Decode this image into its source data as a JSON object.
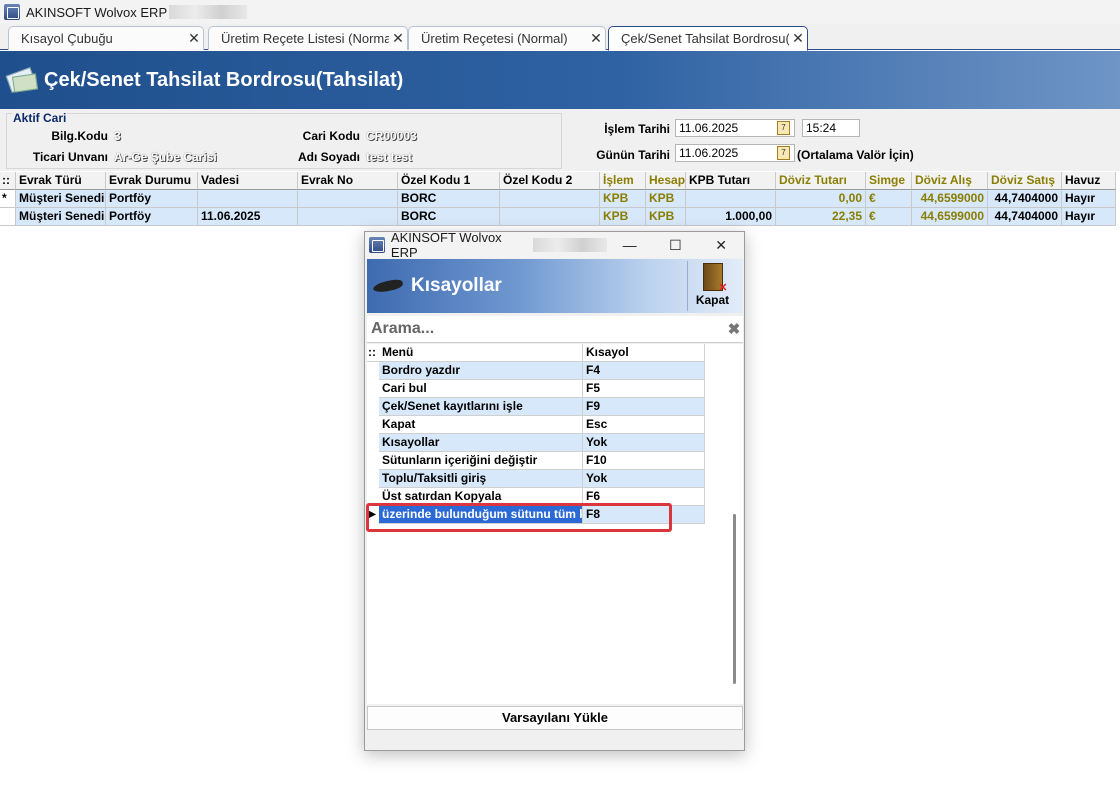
{
  "app": {
    "title": "AKINSOFT Wolvox ERP"
  },
  "tabs": [
    {
      "label": "Kısayol Çubuğu"
    },
    {
      "label": "Üretim Reçete Listesi (Normal)"
    },
    {
      "label": "Üretim Reçetesi (Normal)"
    },
    {
      "label": "Çek/Senet Tahsilat Bordrosu(Tahsilat)"
    }
  ],
  "header": {
    "title": "Çek/Senet Tahsilat Bordrosu(Tahsilat)"
  },
  "aktif_cari": {
    "title": "Aktif Cari",
    "bilg_kodu_label": "Bilg.Kodu",
    "bilg_kodu": "3",
    "ticari_unvan_label": "Ticari Unvanı",
    "ticari_unvan": "Ar-Ge Şube Carisi",
    "cari_kodu_label": "Cari Kodu",
    "cari_kodu": "CR00003",
    "adi_soyadi_label": "Adı Soyadı",
    "adi_soyadi": "test test"
  },
  "dates": {
    "islem_tarihi_label": "İşlem Tarihi",
    "islem_tarihi": "11.06.2025",
    "islem_saati": "15:24",
    "gunun_tarihi_label": "Günün Tarihi",
    "gunun_tarihi": "11.06.2025",
    "calendar_icon_text": "7",
    "ortalama_note": "(Ortalama Valör İçin)"
  },
  "grid": {
    "headers": [
      "::",
      "Evrak Türü",
      "Evrak Durumu",
      "Vadesi",
      "Evrak No",
      "Özel Kodu 1",
      "Özel Kodu 2",
      "İşlem",
      "Hesap",
      "KPB Tutarı",
      "Döviz Tutarı",
      "Simge",
      "Döviz Alış",
      "Döviz Satış",
      "Havuz"
    ],
    "rows": [
      [
        "*",
        "Müşteri Senedi",
        "Portföy",
        "",
        "",
        "BORC",
        "",
        "KPB",
        "KPB",
        "",
        "0,00",
        "€",
        "44,6599000",
        "44,7404000",
        "Hayır"
      ],
      [
        "",
        "Müşteri Senedi",
        "Portföy",
        "11.06.2025",
        "",
        "BORC",
        "",
        "KPB",
        "KPB",
        "1.000,00",
        "22,35",
        "€",
        "44,6599000",
        "44,7404000",
        "Hayır"
      ]
    ]
  },
  "dialog": {
    "title": "AKINSOFT Wolvox ERP",
    "window_buttons": {
      "minimize": "—",
      "maximize": "☐",
      "close": "✕"
    },
    "header_title": "Kısayollar",
    "kapat_label": "Kapat",
    "search_placeholder": "Arama...",
    "search_clear": "✖",
    "columns": [
      "Menü",
      "Kısayol"
    ],
    "col0_header": "::",
    "rows": [
      {
        "menu": "Bordro yazdır",
        "key": "F4"
      },
      {
        "menu": "Cari bul",
        "key": "F5"
      },
      {
        "menu": "Çek/Senet kayıtlarını işle",
        "key": "F9"
      },
      {
        "menu": "Kapat",
        "key": "Esc"
      },
      {
        "menu": "Kısayollar",
        "key": "Yok"
      },
      {
        "menu": "Sütunların içeriğini değiştir",
        "key": "F10"
      },
      {
        "menu": "Toplu/Taksitli giriş",
        "key": "Yok"
      },
      {
        "menu": "Üst satırdan Kopyala",
        "key": "F6"
      },
      {
        "menu": "üzerinde bulunduğum sütunu tüm k",
        "key": "F8"
      }
    ],
    "selected_marker": "▶",
    "varsayilan_button": "Varsayılanı Yükle"
  },
  "colors": {
    "header_blue": "#1f4f8c",
    "selection_blue": "#2b6ad6",
    "row_blue": "#d7e8fa",
    "highlight_red": "#d9363e",
    "gold_text": "#8a7d00"
  }
}
